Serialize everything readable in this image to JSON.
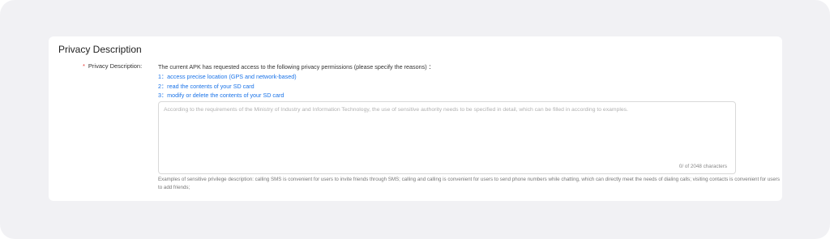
{
  "section": {
    "title": "Privacy Description"
  },
  "field": {
    "label": "Privacy Description:",
    "required_mark": "*",
    "intro": "The current APK has requested access to the following privacy permissions (please specify the reasons) ：",
    "permissions": [
      "1：access precise location (GPS and network-based)",
      "2：read the contents of your SD card",
      "3：modify or delete the contents of your SD card"
    ],
    "textarea": {
      "placeholder": "According to the requirements of the Ministry of Industry and Information Technology, the use of sensitive authority needs to be specified in detail, which can be filled in according to examples.",
      "value": "",
      "char_count": "0/ of 2048 characters"
    },
    "examples": "Examples of sensitive privilege description: calling SMS is convenient for users to invite friends through SMS; calling and calling is convenient for users to send phone numbers while chatting, which can directly meet the needs of dialing calls; visiting contacts is convenient for users to add friends;"
  },
  "colors": {
    "page_bg": "#f1f1f4",
    "card_bg": "#ffffff",
    "link_blue": "#1a73e8",
    "required_red": "#e53935"
  }
}
